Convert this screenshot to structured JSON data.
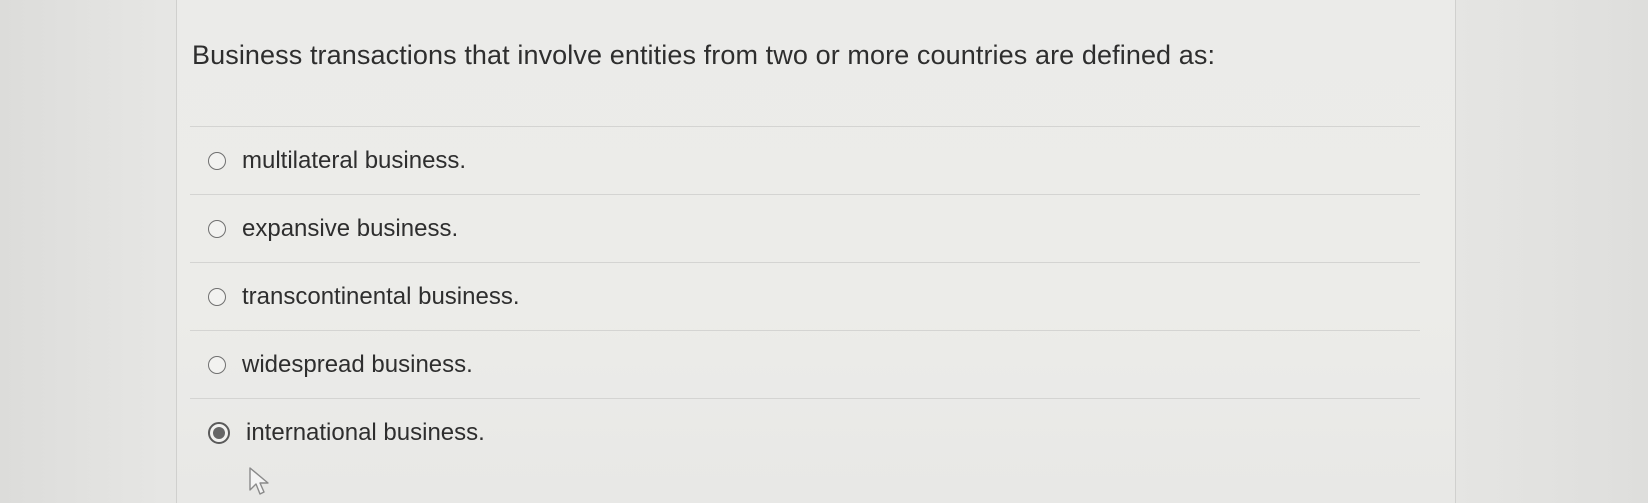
{
  "question": {
    "text": "Business transactions that involve entities from two or more countries are defined as:"
  },
  "options": [
    {
      "label": "multilateral business.",
      "selected": false
    },
    {
      "label": "expansive business.",
      "selected": false
    },
    {
      "label": "transcontinental business.",
      "selected": false
    },
    {
      "label": "widespread business.",
      "selected": false
    },
    {
      "label": "international business.",
      "selected": true
    }
  ],
  "icons": {
    "radio": "radio-button-icon",
    "cursor": "mouse-pointer-icon"
  },
  "colors": {
    "background": "#e4e4e2",
    "text": "#2e2e2e",
    "radio_fill_selected": "#666666"
  }
}
